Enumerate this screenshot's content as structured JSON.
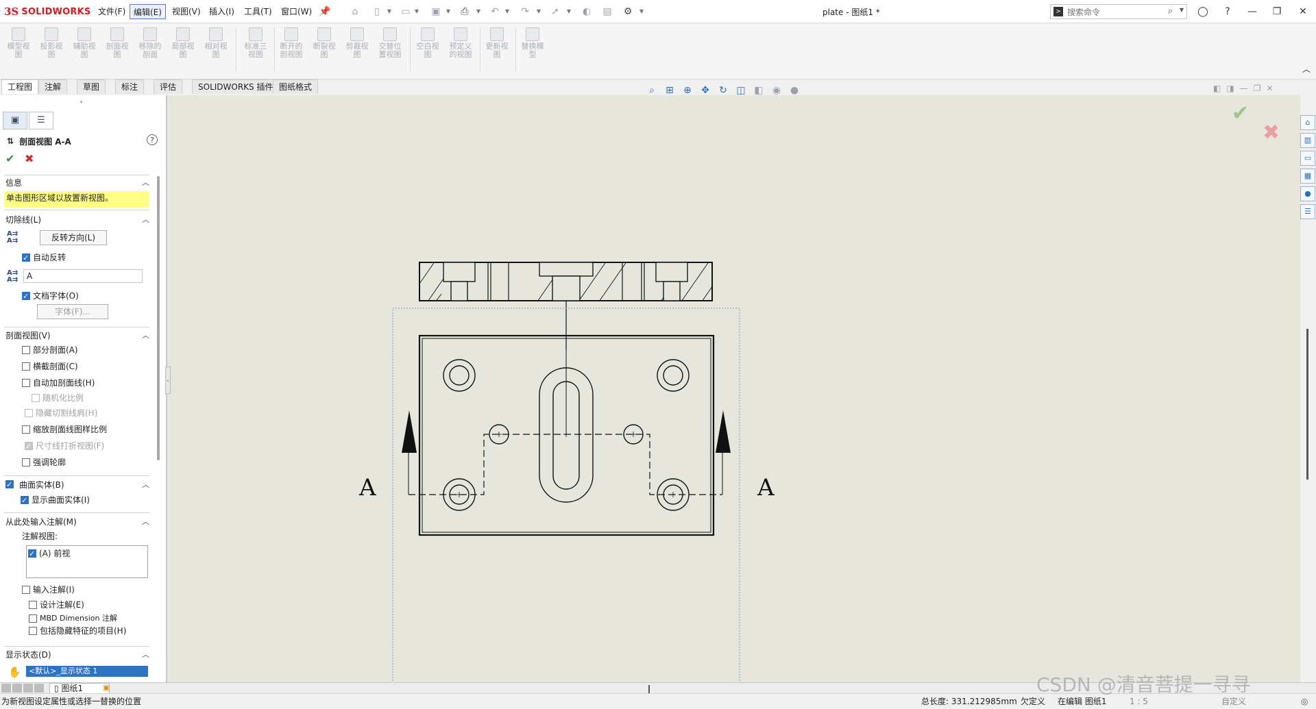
{
  "app": {
    "logo_mark": "3S",
    "logo_text": "SOLIDWORKS",
    "document_title": "plate - 图纸1 *"
  },
  "menu": [
    "文件(F)",
    "编辑(E)",
    "视图(V)",
    "插入(I)",
    "工具(T)",
    "窗口(W)"
  ],
  "search": {
    "placeholder": "搜索命令"
  },
  "ribbon": [
    "模型视\n图",
    "投影视\n图",
    "辅助视\n图",
    "剖面视\n图",
    "移除的\n剖面",
    "局部视\n图",
    "相对视\n图",
    "标准三\n视图",
    "断开的\n剖视图",
    "断裂视\n图",
    "剪裁视\n图",
    "交替位\n置视图",
    "空白视\n图",
    "预定义\n的视图",
    "更新视\n图",
    "替换模\n型"
  ],
  "tabs": [
    "工程图",
    "注解",
    "草图",
    "标注",
    "评估",
    "SOLIDWORKS 插件",
    "图纸格式"
  ],
  "property_manager": {
    "title": "剖面视图 A-A",
    "help": "?",
    "sections": {
      "info": {
        "title": "信息",
        "message": "单击图形区域以放置新视图。"
      },
      "cutting_line": {
        "title": "切除线(L)",
        "flip_button": "反转方向(L)",
        "auto_flip": "自动反转",
        "label_value": "A",
        "doc_font": "文档字体(O)",
        "font_button": "字体(F)..."
      },
      "section_view": {
        "title": "剖面视图(V)",
        "items": [
          {
            "label": "部分剖面(A)",
            "checked": false,
            "disabled": false,
            "indent": 0
          },
          {
            "label": "横截剖面(C)",
            "checked": false,
            "disabled": false,
            "indent": 0
          },
          {
            "label": "自动加剖面线(H)",
            "checked": false,
            "disabled": false,
            "indent": 0
          },
          {
            "label": "随机化比例",
            "checked": false,
            "disabled": true,
            "indent": 1
          },
          {
            "label": "隐藏切割线肩(H)",
            "checked": false,
            "disabled": true,
            "indent": 0
          },
          {
            "label": "缩放剖面线图样比例",
            "checked": false,
            "disabled": false,
            "indent": 0
          },
          {
            "label": "尺寸线打折视图(F)",
            "checked": true,
            "disabled": true,
            "indent": 0
          },
          {
            "label": "强调轮廓",
            "checked": false,
            "disabled": false,
            "indent": 0
          }
        ]
      },
      "surface_bodies": {
        "title": "曲面实体(B)",
        "show": "显示曲面实体(I)"
      },
      "import_annotations": {
        "title": "从此处输入注解(M)",
        "views_label": "注解视图:",
        "view_item": "(A) 前视",
        "import": "输入注解(I)",
        "design": "设计注解(E)",
        "mbd": "MBD Dimension 注解",
        "hidden": "包括隐藏特征的项目(H)"
      },
      "display_state": {
        "title": "显示状态(D)",
        "value": "<默认>_显示状态 1"
      }
    }
  },
  "drawing": {
    "section_label_left": "A",
    "section_label_right": "A"
  },
  "sheet": {
    "tab": "图纸1"
  },
  "status": {
    "message": "为新视图设定属性或选择一替换的位置",
    "length": "总长度: 331.212985mm",
    "defined": "欠定义",
    "editing": "在编辑 图纸1",
    "scale": "1 : 5",
    "custom": "自定义"
  },
  "watermark": "CSDN @清音菩提一寻寻",
  "colors": {
    "accent": "#2d73c4",
    "info_bg": "#ffff88",
    "graphics_bg": "#e7e6dc",
    "brand": "#d71920"
  }
}
